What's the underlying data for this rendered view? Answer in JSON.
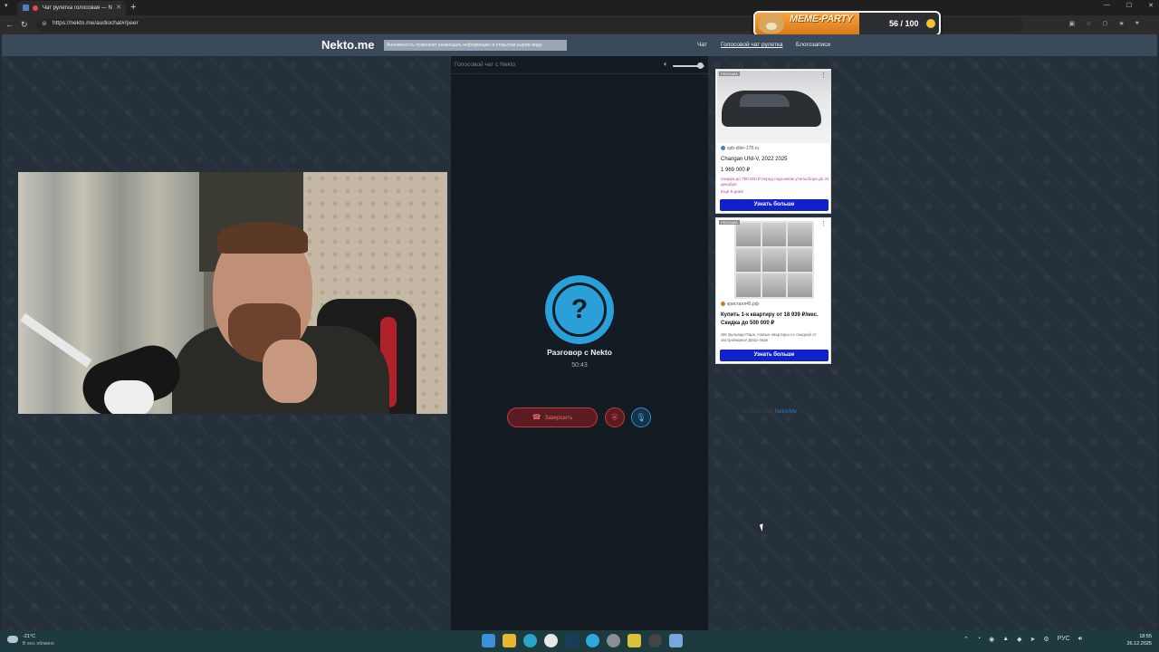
{
  "browser": {
    "tab_title": "Чат рулетка голосовая — N",
    "new_tab": "+",
    "url": "https://nekto.me/audiochat#/peer",
    "window_controls": [
      "—",
      "☐",
      "✕"
    ]
  },
  "overlay": {
    "title": "MEME-PARTY",
    "counter": "56 / 100"
  },
  "site": {
    "logo": "Nekto.me",
    "notice": "Анонимность позволяет размещать информацию в открытом,сыром виде",
    "nav": [
      "Чат",
      "Голосовой чат рулетка",
      "Блогозаписи"
    ]
  },
  "chat": {
    "header": "Голосовой чат с Nekto",
    "volume_level": 0.85,
    "avatar_symbol": "?",
    "title": "Разговор с Nekto",
    "timer": "50:43",
    "end_label": "Завершить"
  },
  "ads": [
    {
      "label": "РЕКЛАМА",
      "domain": "spb-diler-178.ru",
      "headline": "Changan UNI-V, 2022 2025",
      "price": "1 969 000 ₽",
      "promo": "Скидка до 750 000 ₽ перед подъемом утильсбора до 31 декабря",
      "promo2": "Ещё 5 дней",
      "cta": "Узнать больше"
    },
    {
      "label": "РЕКЛАМА",
      "domain": "кристалл45.рф",
      "headline": "Купить 1-к квартиру от 18 939 ₽/мес. Скидка до 500 000 ₽",
      "sub": "ЖК Бульвар-Парк. Новые квартиры со скидкой от застройщика! Двор-парк",
      "cta": "Узнать больше"
    }
  ],
  "footer": {
    "copyright": "© 2011-2025",
    "link": "NektoMe"
  },
  "taskbar": {
    "temp": "-21°C",
    "weather": "В осн. облачно",
    "lang": "РУС",
    "time": "18:55",
    "date": "26.12.2025"
  }
}
